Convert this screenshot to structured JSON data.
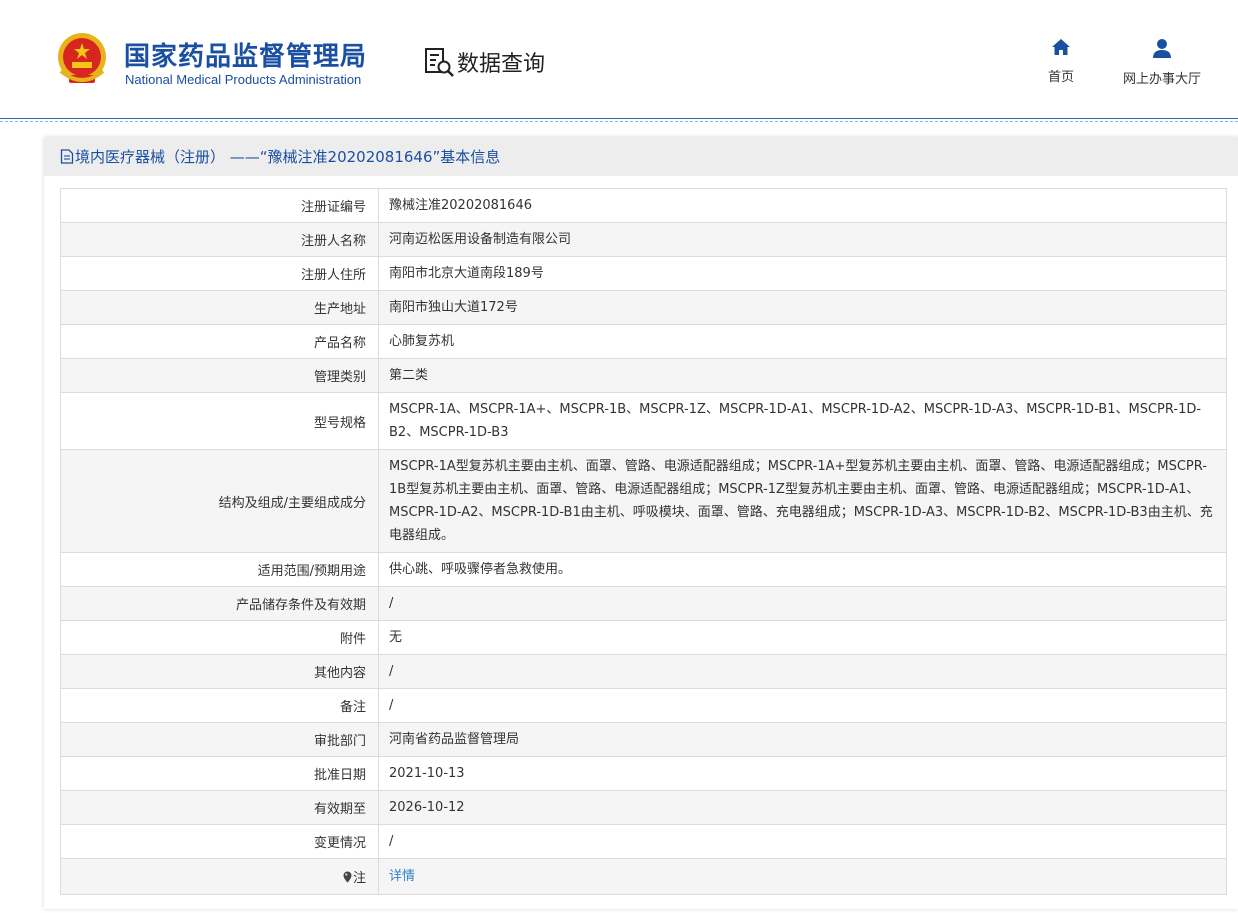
{
  "header": {
    "org_name_cn": "国家药品监督管理局",
    "org_name_en": "National Medical Products Administration",
    "query_label": "数据查询",
    "nav": {
      "home_label": "首页",
      "hall_label": "网上办事大厅"
    }
  },
  "colors": {
    "brand_blue": "#1a4fa3",
    "link_blue": "#2f80c8",
    "panel_header_bg": "#ededed",
    "row_alt_bg": "#f5f5f5"
  },
  "icons": [
    "national-emblem-icon",
    "data-query-icon",
    "home-icon",
    "user-icon",
    "document-icon",
    "pin-icon"
  ],
  "panel": {
    "title": "境内医疗器械（注册） ——“豫械注准20202081646”基本信息"
  },
  "rows": [
    {
      "label": "注册证编号",
      "value": "豫械注准20202081646"
    },
    {
      "label": "注册人名称",
      "value": "河南迈松医用设备制造有限公司"
    },
    {
      "label": "注册人住所",
      "value": "南阳市北京大道南段189号"
    },
    {
      "label": "生产地址",
      "value": "南阳市独山大道172号"
    },
    {
      "label": "产品名称",
      "value": "心肺复苏机"
    },
    {
      "label": "管理类别",
      "value": "第二类"
    },
    {
      "label": "型号规格",
      "value": "MSCPR-1A、MSCPR-1A+、MSCPR-1B、MSCPR-1Z、MSCPR-1D-A1、MSCPR-1D-A2、MSCPR-1D-A3、MSCPR-1D-B1、MSCPR-1D-B2、MSCPR-1D-B3"
    },
    {
      "label": "结构及组成/主要组成成分",
      "value": "MSCPR-1A型复苏机主要由主机、面罩、管路、电源适配器组成；MSCPR-1A+型复苏机主要由主机、面罩、管路、电源适配器组成；MSCPR-1B型复苏机主要由主机、面罩、管路、电源适配器组成；MSCPR-1Z型复苏机主要由主机、面罩、管路、电源适配器组成；MSCPR-1D-A1、MSCPR-1D-A2、MSCPR-1D-B1由主机、呼吸模块、面罩、管路、充电器组成；MSCPR-1D-A3、MSCPR-1D-B2、MSCPR-1D-B3由主机、充电器组成。"
    },
    {
      "label": "适用范围/预期用途",
      "value": "供心跳、呼吸骤停者急救使用。"
    },
    {
      "label": "产品储存条件及有效期",
      "value": "/"
    },
    {
      "label": "附件",
      "value": "无"
    },
    {
      "label": "其他内容",
      "value": "/"
    },
    {
      "label": "备注",
      "value": "/"
    },
    {
      "label": "审批部门",
      "value": "河南省药品监督管理局"
    },
    {
      "label": "批准日期",
      "value": "2021-10-13"
    },
    {
      "label": "有效期至",
      "value": "2026-10-12"
    },
    {
      "label": "变更情况",
      "value": "/"
    }
  ],
  "note_row": {
    "label": "注",
    "link_label": "详情"
  }
}
